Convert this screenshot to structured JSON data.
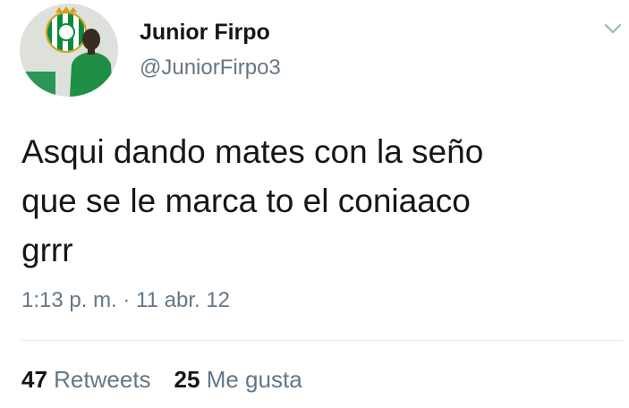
{
  "user": {
    "name": "Junior Firpo",
    "handle": "@JuniorFirpo3"
  },
  "tweet": {
    "lines": [
      "Asqui dando mates con la seño",
      "que se le marca to el coniaaco",
      "grrr"
    ],
    "timestamp": "1:13 p. m. · 11 abr. 12"
  },
  "stats": {
    "retweets_count": "47",
    "retweets_label": "Retweets",
    "likes_count": "25",
    "likes_label": "Me gusta"
  },
  "icons": {
    "menu": "chevron-down-icon"
  },
  "colors": {
    "text_primary": "#14171a",
    "text_secondary": "#657786",
    "divider": "#e1e8ed",
    "crest_green": "#0b8a3e",
    "crest_gold": "#d4a017"
  }
}
